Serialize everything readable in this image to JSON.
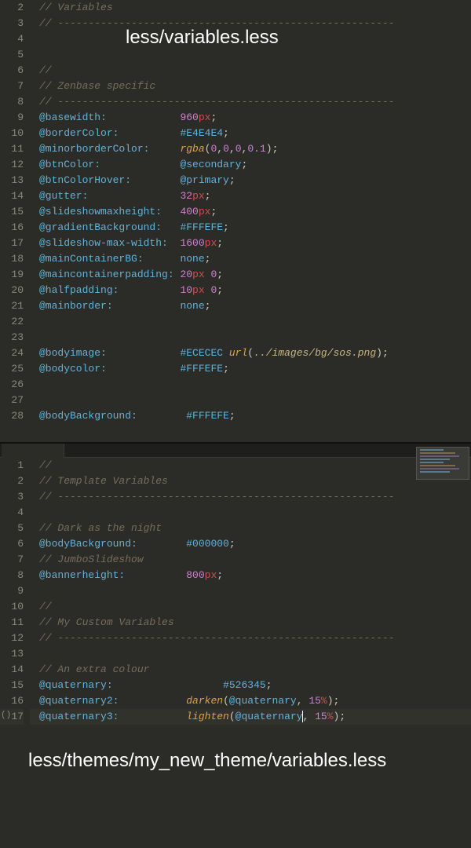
{
  "caption1": "less/variables.less",
  "caption2": "less/themes/my_new_theme/variables.less",
  "top": {
    "startLine": 2,
    "lines": [
      {
        "t": "comment",
        "text": "// Variables"
      },
      {
        "t": "comment",
        "text": "// -------------------------------------------------------"
      },
      {
        "t": "blank"
      },
      {
        "t": "blank"
      },
      {
        "t": "comment",
        "text": "//"
      },
      {
        "t": "comment",
        "text": "// Zenbase specific"
      },
      {
        "t": "comment",
        "text": "// -------------------------------------------------------"
      },
      {
        "t": "decl",
        "name": "@basewidth:",
        "pad": "            ",
        "val": [
          {
            "k": "num",
            "v": "960"
          },
          {
            "k": "unit",
            "v": "px"
          }
        ]
      },
      {
        "t": "decl",
        "name": "@borderColor:",
        "pad": "          ",
        "val": [
          {
            "k": "hex",
            "v": "#E4E4E4"
          }
        ]
      },
      {
        "t": "decl",
        "name": "@minorborderColor:",
        "pad": "     ",
        "val": [
          {
            "k": "func",
            "v": "rgba"
          },
          {
            "k": "paren",
            "v": "("
          },
          {
            "k": "num",
            "v": "0"
          },
          {
            "k": "paren",
            "v": ","
          },
          {
            "k": "num",
            "v": "0"
          },
          {
            "k": "paren",
            "v": ","
          },
          {
            "k": "num",
            "v": "0"
          },
          {
            "k": "paren",
            "v": ","
          },
          {
            "k": "num",
            "v": "0.1"
          },
          {
            "k": "paren",
            "v": ")"
          }
        ]
      },
      {
        "t": "decl",
        "name": "@btnColor:",
        "pad": "             ",
        "val": [
          {
            "k": "ident",
            "v": "@secondary"
          }
        ]
      },
      {
        "t": "decl",
        "name": "@btnColorHover:",
        "pad": "        ",
        "val": [
          {
            "k": "ident",
            "v": "@primary"
          }
        ]
      },
      {
        "t": "decl",
        "name": "@gutter:",
        "pad": "               ",
        "val": [
          {
            "k": "num",
            "v": "32"
          },
          {
            "k": "unit",
            "v": "px"
          }
        ]
      },
      {
        "t": "decl",
        "name": "@slideshowmaxheight:",
        "pad": "   ",
        "val": [
          {
            "k": "num",
            "v": "400"
          },
          {
            "k": "unit",
            "v": "px"
          }
        ]
      },
      {
        "t": "decl",
        "name": "@gradientBackground:",
        "pad": "   ",
        "val": [
          {
            "k": "hex",
            "v": "#FFFEFE"
          }
        ]
      },
      {
        "t": "decl",
        "name": "@slideshow-max-width:",
        "pad": "  ",
        "val": [
          {
            "k": "num",
            "v": "1600"
          },
          {
            "k": "unit",
            "v": "px"
          }
        ]
      },
      {
        "t": "decl",
        "name": "@mainContainerBG:",
        "pad": "      ",
        "val": [
          {
            "k": "kw",
            "v": "none"
          }
        ]
      },
      {
        "t": "decl",
        "name": "@maincontainerpadding:",
        "pad": " ",
        "val": [
          {
            "k": "num",
            "v": "20"
          },
          {
            "k": "unit",
            "v": "px"
          },
          {
            "k": "plain",
            "v": " "
          },
          {
            "k": "zero",
            "v": "0"
          }
        ]
      },
      {
        "t": "decl",
        "name": "@halfpadding:",
        "pad": "          ",
        "val": [
          {
            "k": "num",
            "v": "10"
          },
          {
            "k": "unit",
            "v": "px"
          },
          {
            "k": "plain",
            "v": " "
          },
          {
            "k": "zero",
            "v": "0"
          }
        ]
      },
      {
        "t": "decl",
        "name": "@mainborder:",
        "pad": "           ",
        "val": [
          {
            "k": "kw",
            "v": "none"
          }
        ]
      },
      {
        "t": "blank"
      },
      {
        "t": "blank"
      },
      {
        "t": "decl",
        "name": "@bodyimage:",
        "pad": "            ",
        "val": [
          {
            "k": "hex",
            "v": "#ECECEC"
          },
          {
            "k": "plain",
            "v": " "
          },
          {
            "k": "func",
            "v": "url"
          },
          {
            "k": "paren",
            "v": "("
          },
          {
            "k": "string",
            "v": "../images/bg/sos.png"
          },
          {
            "k": "paren",
            "v": ")"
          }
        ]
      },
      {
        "t": "decl",
        "name": "@bodycolor:",
        "pad": "            ",
        "val": [
          {
            "k": "hex",
            "v": "#FFFEFE"
          }
        ]
      },
      {
        "t": "blank"
      },
      {
        "t": "blank"
      },
      {
        "t": "decl",
        "name": "@bodyBackground:",
        "pad": "        ",
        "val": [
          {
            "k": "hex",
            "v": "#FFFEFE"
          }
        ]
      }
    ]
  },
  "bottom": {
    "startLine": 1,
    "lines": [
      {
        "t": "comment",
        "text": "//"
      },
      {
        "t": "comment",
        "text": "// Template Variables"
      },
      {
        "t": "comment",
        "text": "// -------------------------------------------------------"
      },
      {
        "t": "blank"
      },
      {
        "t": "comment",
        "text": "// Dark as the night"
      },
      {
        "t": "decl",
        "name": "@bodyBackground:",
        "pad": "        ",
        "val": [
          {
            "k": "hex",
            "v": "#000000"
          }
        ]
      },
      {
        "t": "comment",
        "text": "// JumboSlideshow"
      },
      {
        "t": "decl",
        "name": "@bannerheight:",
        "pad": "          ",
        "val": [
          {
            "k": "num",
            "v": "800"
          },
          {
            "k": "unit",
            "v": "px"
          }
        ]
      },
      {
        "t": "blank"
      },
      {
        "t": "comment",
        "text": "//"
      },
      {
        "t": "comment",
        "text": "// My Custom Variables"
      },
      {
        "t": "comment",
        "text": "// -------------------------------------------------------"
      },
      {
        "t": "blank"
      },
      {
        "t": "comment",
        "text": "// An extra colour"
      },
      {
        "t": "decl",
        "name": "@quaternary:",
        "pad": "                  ",
        "val": [
          {
            "k": "hex",
            "v": "#526345"
          }
        ]
      },
      {
        "t": "decl",
        "name": "@quaternary2:",
        "pad": "           ",
        "val": [
          {
            "k": "func",
            "v": "darken"
          },
          {
            "k": "paren",
            "v": "("
          },
          {
            "k": "ident",
            "v": "@quaternary"
          },
          {
            "k": "paren",
            "v": ", "
          },
          {
            "k": "num",
            "v": "15"
          },
          {
            "k": "unit",
            "v": "%"
          },
          {
            "k": "paren",
            "v": ")"
          }
        ]
      },
      {
        "t": "decl",
        "name": "@quaternary3:",
        "pad": "           ",
        "val": [
          {
            "k": "func",
            "v": "lighten"
          },
          {
            "k": "paren",
            "v": "("
          },
          {
            "k": "ident",
            "v": "@quaternary"
          },
          {
            "k": "cursor",
            "v": ""
          },
          {
            "k": "paren",
            "v": ", "
          },
          {
            "k": "num",
            "v": "15"
          },
          {
            "k": "unit",
            "v": "%"
          },
          {
            "k": "paren",
            "v": ")"
          }
        ],
        "hl": true,
        "fold": true
      }
    ]
  }
}
